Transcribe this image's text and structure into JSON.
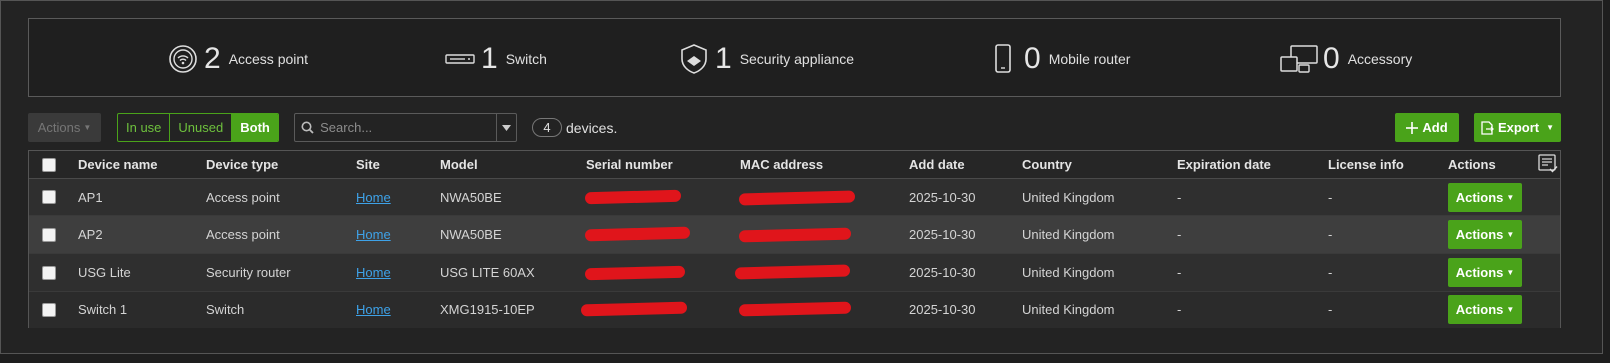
{
  "summary": [
    {
      "count": "2",
      "label": "Access point",
      "icon": "wifi-icon"
    },
    {
      "count": "1",
      "label": "Switch",
      "icon": "switch-icon"
    },
    {
      "count": "1",
      "label": "Security appliance",
      "icon": "shield-icon"
    },
    {
      "count": "0",
      "label": "Mobile router",
      "icon": "mobile-icon"
    },
    {
      "count": "0",
      "label": "Accessory",
      "icon": "accessory-icon"
    }
  ],
  "toolbar": {
    "actions_label": "Actions",
    "filters": [
      "In use",
      "Unused",
      "Both"
    ],
    "active_filter": "Both",
    "search_placeholder": "Search...",
    "device_count": "4",
    "device_count_suffix": "devices.",
    "add_label": "Add",
    "export_label": "Export"
  },
  "table": {
    "columns": [
      "Device name",
      "Device type",
      "Site",
      "Model",
      "Serial number",
      "MAC address",
      "Add date",
      "Country",
      "Expiration date",
      "License info",
      "Actions"
    ],
    "rows": [
      {
        "name": "AP1",
        "type": "Access point",
        "site": "Home",
        "model": "NWA50BE",
        "add_date": "2025-10-30",
        "country": "United Kingdom",
        "expiration": "-",
        "license": "-",
        "action": "Actions"
      },
      {
        "name": "AP2",
        "type": "Access point",
        "site": "Home",
        "model": "NWA50BE",
        "add_date": "2025-10-30",
        "country": "United Kingdom",
        "expiration": "-",
        "license": "-",
        "action": "Actions"
      },
      {
        "name": "USG Lite",
        "type": "Security router",
        "site": "Home",
        "model": "USG LITE 60AX",
        "add_date": "2025-10-30",
        "country": "United Kingdom",
        "expiration": "-",
        "license": "-",
        "action": "Actions"
      },
      {
        "name": "Switch 1",
        "type": "Switch",
        "site": "Home",
        "model": "XMG1915-10EP",
        "add_date": "2025-10-30",
        "country": "United Kingdom",
        "expiration": "-",
        "license": "-",
        "action": "Actions"
      }
    ]
  },
  "colors": {
    "accent": "#4aa31a",
    "link": "#3ea2e8",
    "redaction": "#e0151b"
  }
}
